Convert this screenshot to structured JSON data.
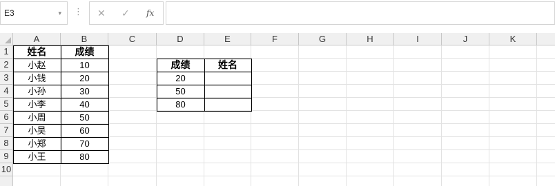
{
  "formula_bar": {
    "name_box": "E3",
    "name_box_arrow": "▾",
    "dots": "⋮",
    "cancel_icon": "✕",
    "enter_icon": "✓",
    "fx_label": "fx",
    "formula": ""
  },
  "columns": [
    "A",
    "B",
    "C",
    "D",
    "E",
    "F",
    "G",
    "H",
    "I",
    "J",
    "K"
  ],
  "rows": [
    "1",
    "2",
    "3",
    "4",
    "5",
    "6",
    "7",
    "8",
    "9",
    "10"
  ],
  "table1": {
    "headers": [
      "姓名",
      "成绩"
    ],
    "rows": [
      [
        "小赵",
        "10"
      ],
      [
        "小钱",
        "20"
      ],
      [
        "小孙",
        "30"
      ],
      [
        "小李",
        "40"
      ],
      [
        "小周",
        "50"
      ],
      [
        "小吴",
        "60"
      ],
      [
        "小郑",
        "70"
      ],
      [
        "小王",
        "80"
      ]
    ]
  },
  "table2": {
    "headers": [
      "成绩",
      "姓名"
    ],
    "rows": [
      [
        "20",
        ""
      ],
      [
        "50",
        ""
      ],
      [
        "80",
        ""
      ]
    ]
  },
  "selected_cell": "E3",
  "accent_color": "#217346"
}
